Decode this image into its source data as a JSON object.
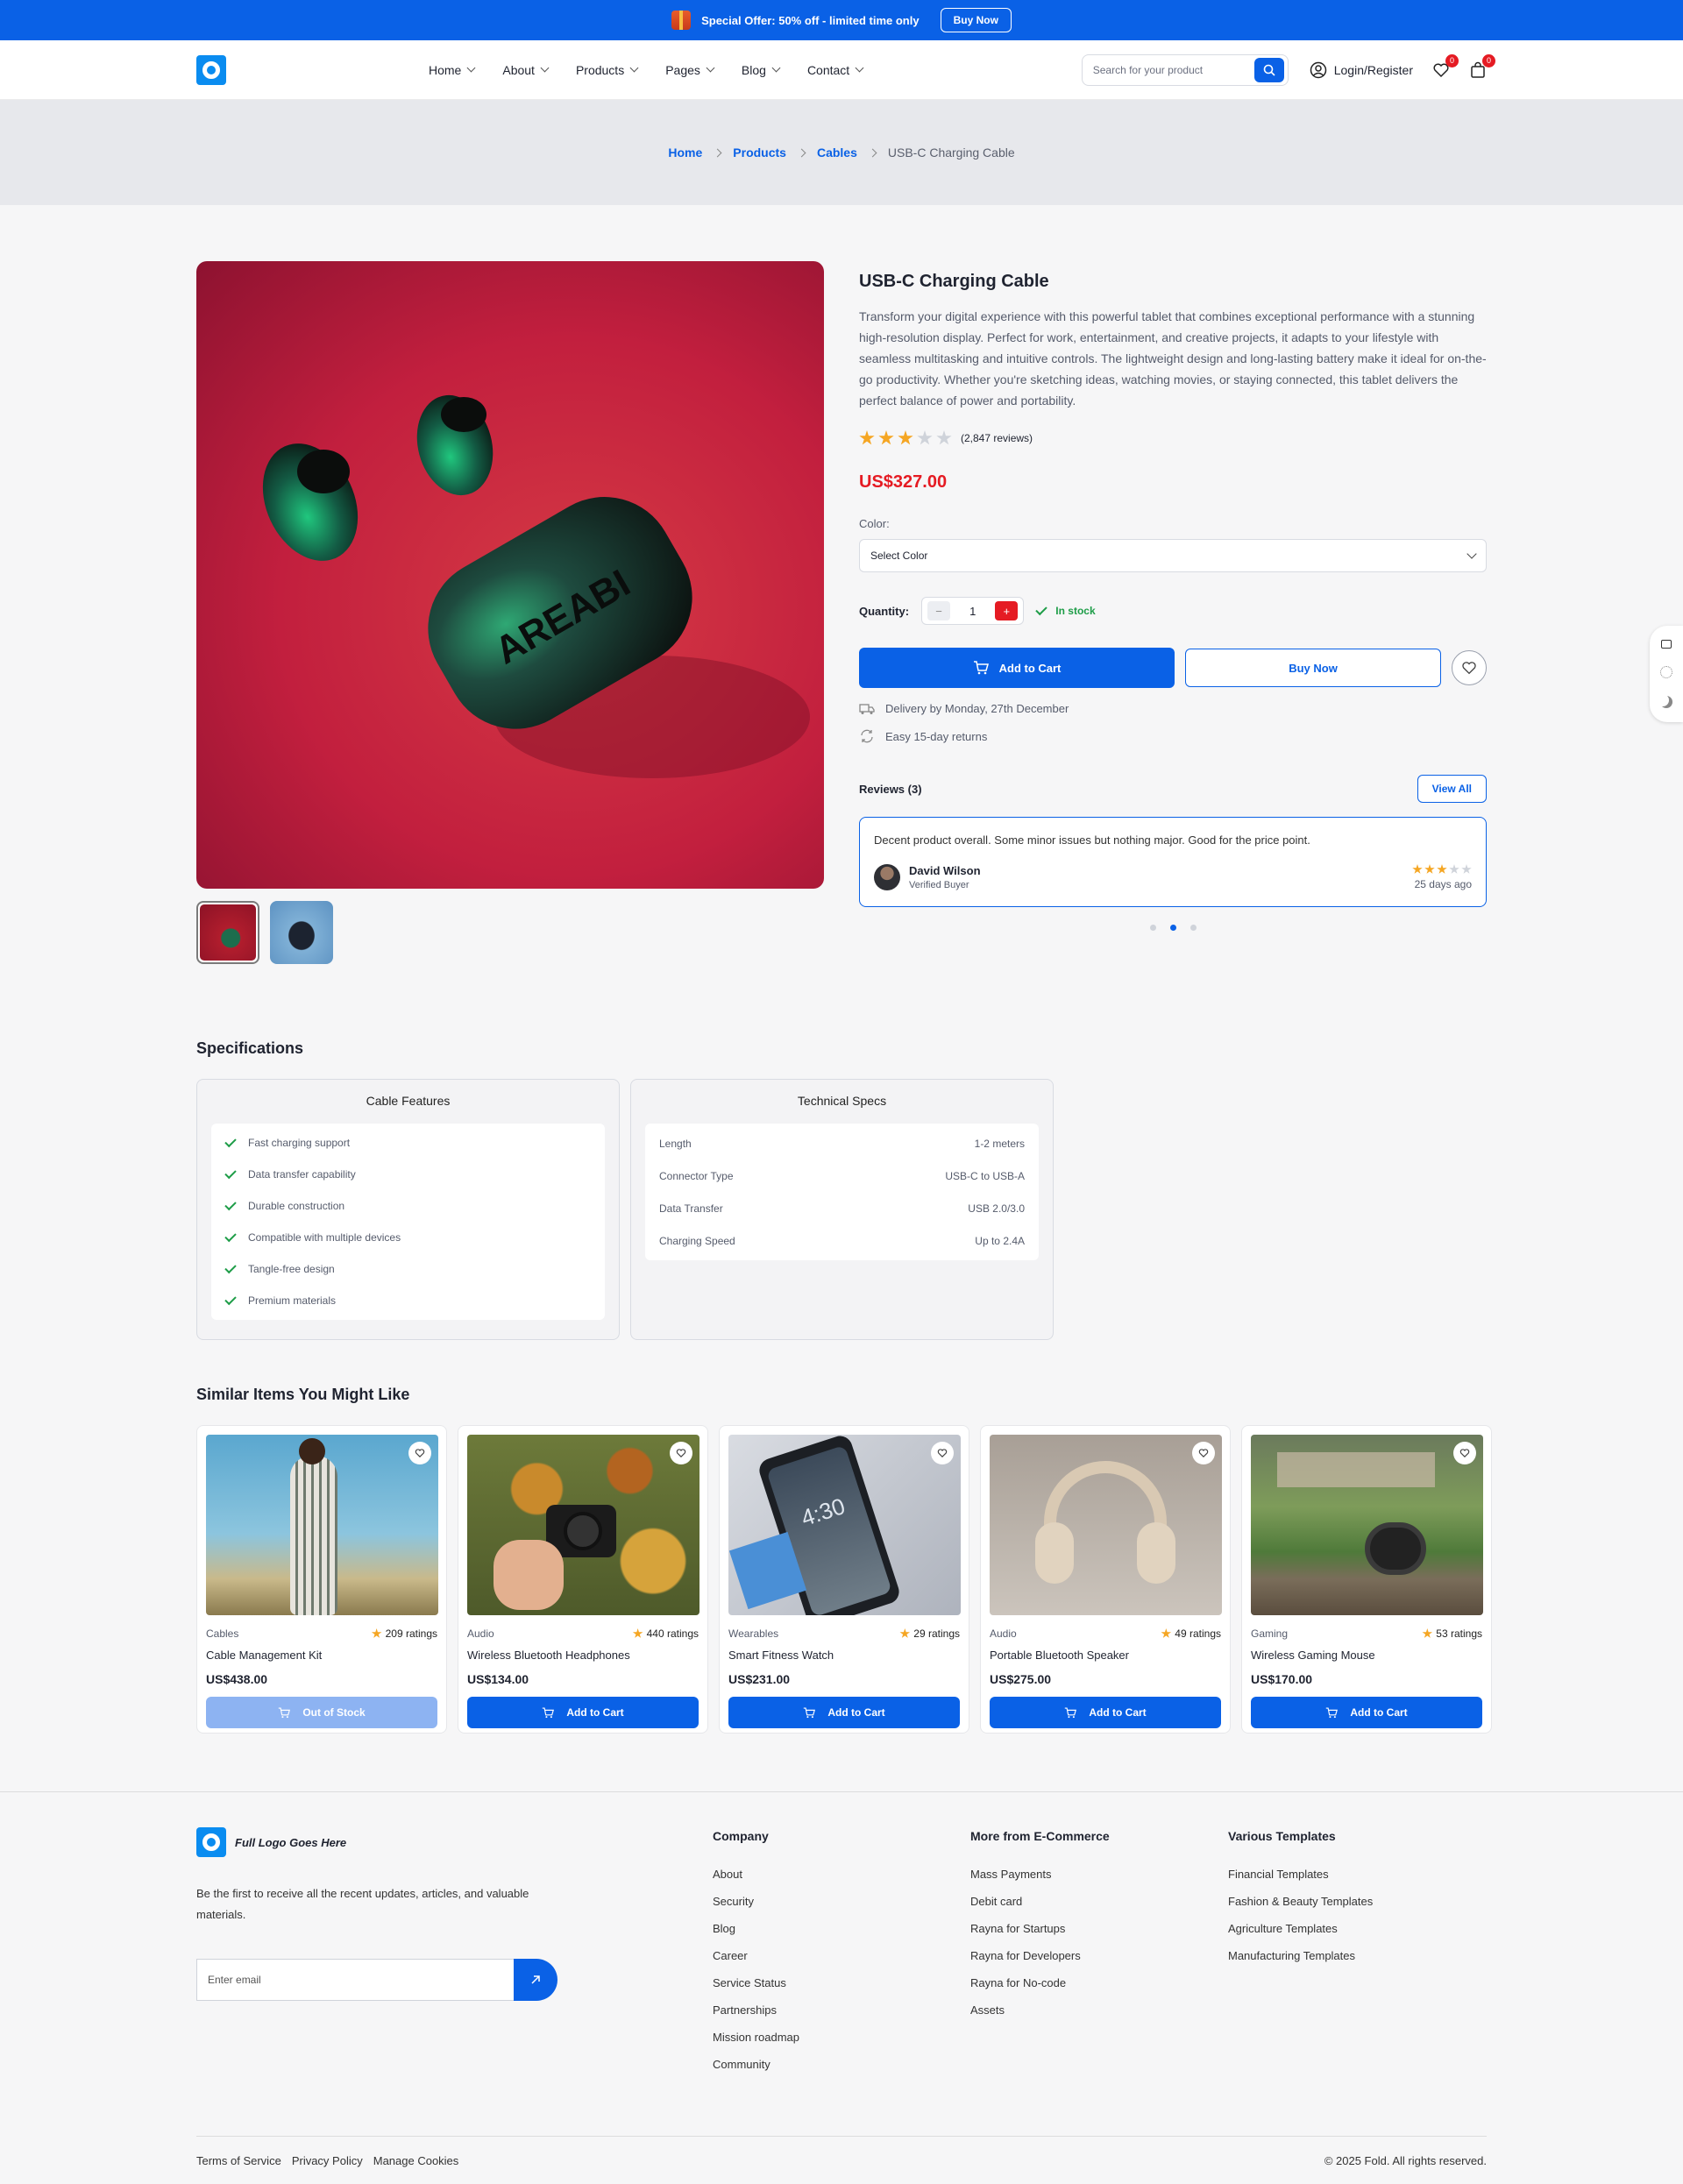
{
  "promo": {
    "text": "Special Offer: 50% off - limited time only",
    "button": "Buy Now"
  },
  "nav": {
    "items": [
      "Home",
      "About",
      "Products",
      "Pages",
      "Blog",
      "Contact"
    ],
    "search_placeholder": "Search for your product",
    "login": "Login/Register",
    "wishlist_count": "0",
    "cart_count": "0"
  },
  "breadcrumb": {
    "home": "Home",
    "products": "Products",
    "cables": "Cables",
    "current": "USB-C Charging Cable"
  },
  "product": {
    "title": "USB-C Charging Cable",
    "description": "Transform your digital experience with this powerful tablet that combines exceptional performance with a stunning high-resolution display. Perfect for work, entertainment, and creative projects, it adapts to your lifestyle with seamless multitasking and intuitive controls. The lightweight design and long-lasting battery make it ideal for on-the-go productivity. Whether you're sketching ideas, watching movies, or staying connected, this tablet delivers the perfect balance of power and portability.",
    "rating": 3,
    "rating_max": 5,
    "reviews_count": "(2,847 reviews)",
    "price": "US$327.00",
    "color_label": "Color:",
    "color_value": "Select Color",
    "quantity_label": "Quantity:",
    "quantity": "1",
    "stock": "In stock",
    "add_to_cart": "Add to Cart",
    "buy_now": "Buy Now",
    "delivery": "Delivery by Monday, 27th December",
    "returns": "Easy 15-day returns",
    "image_brand_text": "AREABI"
  },
  "reviews": {
    "title": "Reviews (3)",
    "view_all": "View All",
    "text": "Decent product overall. Some minor issues but nothing major. Good for the price point.",
    "author": "David Wilson",
    "role": "Verified Buyer",
    "rating": 3,
    "date": "25 days ago",
    "active_dot": 1,
    "dot_count": 3
  },
  "specifications": {
    "title": "Specifications",
    "features_title": "Cable Features",
    "features": [
      "Fast charging support",
      "Data transfer capability",
      "Durable construction",
      "Compatible with multiple devices",
      "Tangle-free design",
      "Premium materials"
    ],
    "tech_title": "Technical Specs",
    "tech": [
      {
        "k": "Length",
        "v": "1-2 meters"
      },
      {
        "k": "Connector Type",
        "v": "USB-C to USB-A"
      },
      {
        "k": "Data Transfer",
        "v": "USB 2.0/3.0"
      },
      {
        "k": "Charging Speed",
        "v": "Up to 2.4A"
      }
    ]
  },
  "similar": {
    "title": "Similar Items You Might Like",
    "items": [
      {
        "category": "Cables",
        "ratings": "209 ratings",
        "name": "Cable Management Kit",
        "price": "US$438.00",
        "button": "Out of Stock"
      },
      {
        "category": "Audio",
        "ratings": "440 ratings",
        "name": "Wireless Bluetooth Headphones",
        "price": "US$134.00",
        "button": "Add to Cart"
      },
      {
        "category": "Wearables",
        "ratings": "29 ratings",
        "name": "Smart Fitness Watch",
        "price": "US$231.00",
        "button": "Add to Cart"
      },
      {
        "category": "Audio",
        "ratings": "49 ratings",
        "name": "Portable Bluetooth Speaker",
        "price": "US$275.00",
        "button": "Add to Cart"
      },
      {
        "category": "Gaming",
        "ratings": "53 ratings",
        "name": "Wireless Gaming Mouse",
        "price": "US$170.00",
        "button": "Add to Cart"
      }
    ],
    "phone_time": "4:30"
  },
  "footer": {
    "logo_text": "Full Logo Goes Here",
    "blurb": "Be the first to receive all the recent updates, articles, and valuable materials.",
    "email_placeholder": "Enter email",
    "company_title": "Company",
    "company": [
      "About",
      "Security",
      "Blog",
      "Career",
      "Service Status",
      "Partnerships",
      "Mission roadmap",
      "Community"
    ],
    "more_title": "More from E-Commerce",
    "more": [
      "Mass Payments",
      "Debit card",
      "Rayna for Startups",
      "Rayna for Developers",
      "Rayna for No-code",
      "Assets"
    ],
    "templates_title": "Various Templates",
    "templates": [
      "Financial Templates",
      "Fashion & Beauty Templates",
      "Agriculture Templates",
      "Manufacturing Templates"
    ],
    "terms": "Terms of Service",
    "privacy": "Privacy Policy",
    "cookies": "Manage Cookies",
    "copyright": "© 2025 Fold. All rights reserved."
  },
  "colors": {
    "primary": "#0a61e6",
    "price": "#e51b23",
    "stock": "#1e9d48",
    "star": "#f5a623"
  }
}
